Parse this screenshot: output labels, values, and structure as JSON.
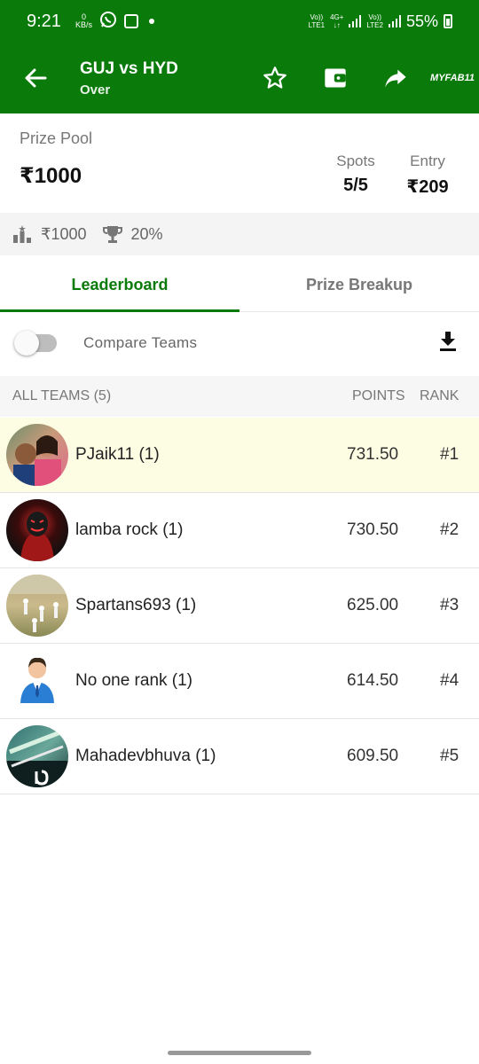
{
  "status_bar": {
    "time": "9:21",
    "speed_value": "0",
    "speed_unit": "KB/s",
    "net1_top": "Vo))",
    "net1_bottom": "LTE1",
    "net2_top": "4G+",
    "net3_top": "Vo))",
    "net3_bottom": "LTE2",
    "battery": "55%"
  },
  "app_bar": {
    "title": "GUJ vs HYD",
    "subtitle": "Over",
    "brand": "MYFAB11"
  },
  "prize_card": {
    "pool_label": "Prize Pool",
    "pool_value": "₹1000",
    "spots_label": "Spots",
    "spots_value": "5/5",
    "entry_label": "Entry",
    "entry_value": "₹209"
  },
  "info_strip": {
    "first_prize": "₹1000",
    "winners_percent": "20%"
  },
  "tabs": [
    {
      "label": "Leaderboard",
      "active": true
    },
    {
      "label": "Prize Breakup",
      "active": false
    }
  ],
  "compare": {
    "label": "Compare Teams",
    "enabled": false
  },
  "list_header": {
    "all_teams": "ALL TEAMS (5)",
    "points": "POINTS",
    "rank": "RANK"
  },
  "teams": [
    {
      "name": "PJaik11 (1)",
      "points": "731.50",
      "rank": "#1"
    },
    {
      "name": "lamba rock (1)",
      "points": "730.50",
      "rank": "#2"
    },
    {
      "name": "Spartans693 (1)",
      "points": "625.00",
      "rank": "#3"
    },
    {
      "name": "No one rank (1)",
      "points": "614.50",
      "rank": "#4"
    },
    {
      "name": "Mahadevbhuva (1)",
      "points": "609.50",
      "rank": "#5"
    }
  ],
  "colors": {
    "brand_green": "#0a7a0a",
    "highlight_row": "#fdfde3"
  }
}
